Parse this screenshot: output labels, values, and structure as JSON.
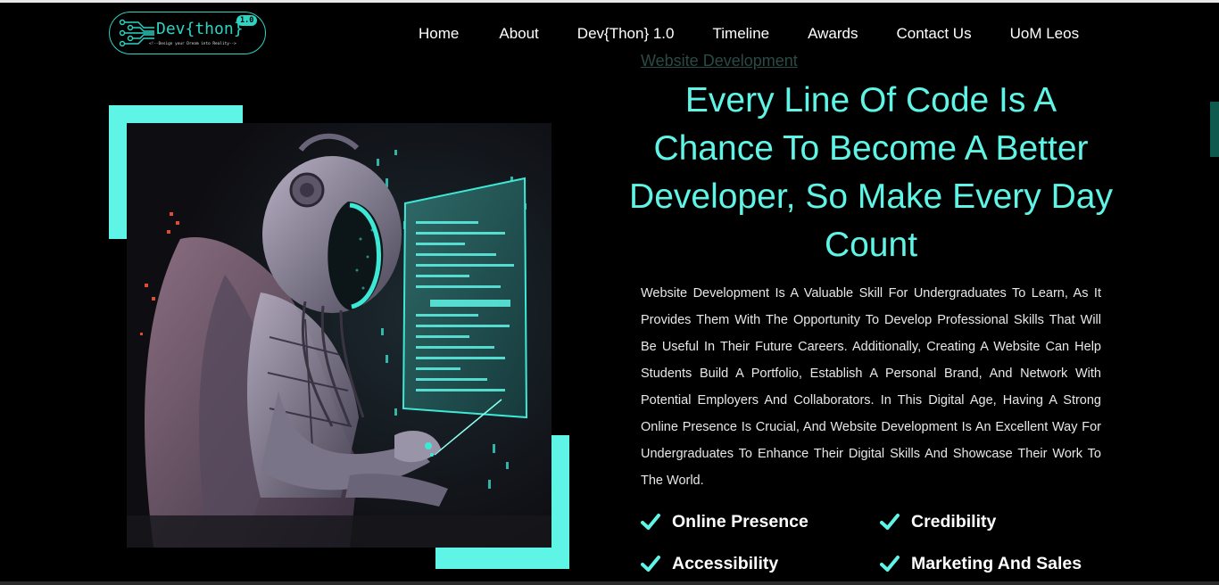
{
  "header": {
    "logo": {
      "text": "Dev{thon}",
      "badge": "1.0",
      "tagline": "<!--Design your Dream into Reality-->"
    },
    "nav": [
      {
        "label": "Home"
      },
      {
        "label": "About"
      },
      {
        "label": "Dev{Thon} 1.0"
      },
      {
        "label": "Timeline"
      },
      {
        "label": "Awards"
      },
      {
        "label": "Contact Us"
      },
      {
        "label": "UoM Leos"
      }
    ]
  },
  "hero": {
    "image_icon": "robot-coding-illustration",
    "eyebrow": "Website Development",
    "headline": "Every Line Of Code Is A Chance To Become A Better Developer, So Make Every Day Count",
    "description": "Website Development Is A Valuable Skill For Undergraduates To Learn, As It Provides Them With The Opportunity To Develop Professional Skills That Will Be Useful In Their Future Careers. Additionally, Creating A Website Can Help Students Build A Portfolio, Establish A Personal Brand, And Network With Potential Employers And Collaborators. In This Digital Age, Having A Strong Online Presence Is Crucial, And Website Development Is An Excellent Way For Undergraduates To Enhance Their Digital Skills And Showcase Their Work To The World.",
    "features": [
      {
        "label": "Online Presence",
        "icon": "check-icon"
      },
      {
        "label": "Credibility",
        "icon": "check-icon"
      },
      {
        "label": "Accessibility",
        "icon": "check-icon"
      },
      {
        "label": "Marketing And Sales",
        "icon": "check-icon"
      }
    ]
  },
  "colors": {
    "accent": "#5ff5e6",
    "logo": "#2fd3c3",
    "background": "#000000",
    "text": "#ffffff"
  }
}
